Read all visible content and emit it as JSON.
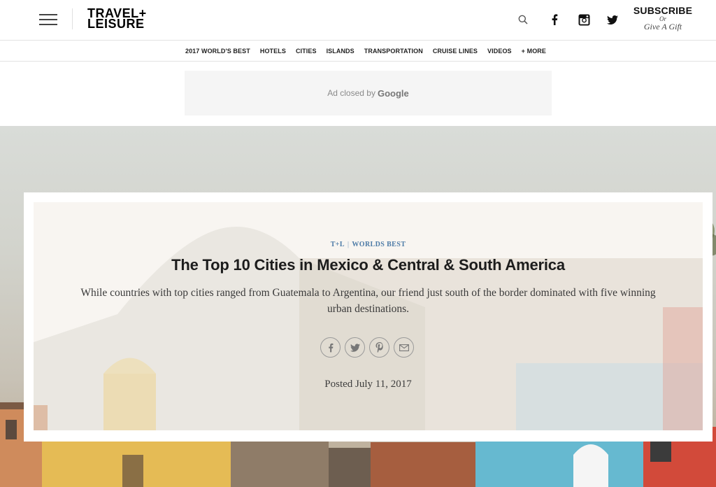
{
  "header": {
    "logo_line1": "TRAVEL+",
    "logo_line2": "LEISURE",
    "icons": [
      "menu-icon",
      "search-icon",
      "facebook-icon",
      "instagram-icon",
      "twitter-icon"
    ],
    "subscribe_label": "SUBSCRIBE",
    "or_label": "Or",
    "gift_label": "Give A Gift"
  },
  "nav": {
    "items": [
      "2017 WORLD'S BEST",
      "HOTELS",
      "CITIES",
      "ISLANDS",
      "TRANSPORTATION",
      "CRUISE LINES",
      "VIDEOS",
      "+ MORE"
    ]
  },
  "ad": {
    "text": "Ad closed by",
    "brand": "Google"
  },
  "article": {
    "kicker_brand": "T+L",
    "kicker_separator": "|",
    "kicker_section": "WORLDS BEST",
    "title": "The Top 10 Cities in Mexico & Central & South America",
    "dek": "While countries with top cities ranged from Guatemala to Argentina, our friend just south of the border dominated with five winning urban destinations.",
    "share_icons": [
      "facebook-icon",
      "twitter-icon",
      "pinterest-icon",
      "email-icon"
    ],
    "posted": "Posted July 11, 2017"
  },
  "colors": {
    "kicker": "#4d7ba7",
    "title": "#1c1c1c"
  }
}
